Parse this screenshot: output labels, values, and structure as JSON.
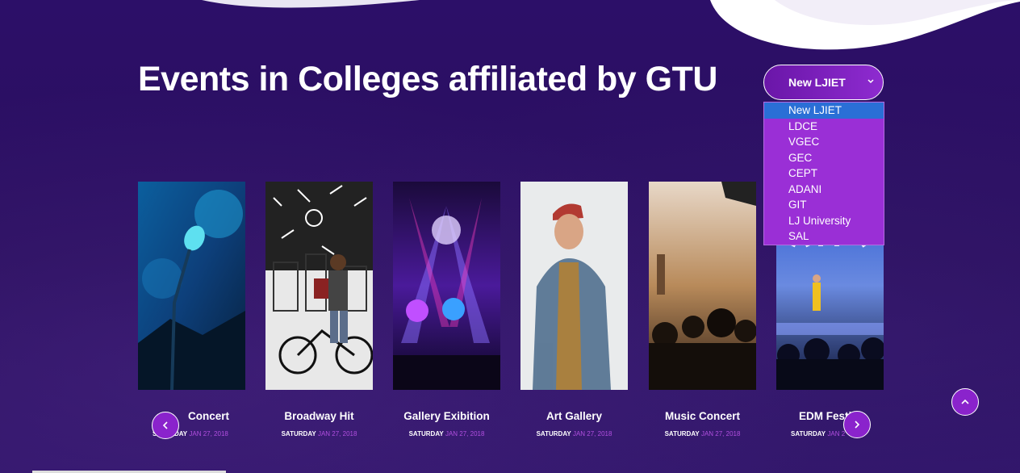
{
  "page": {
    "title": "Events in Colleges affiliated by GTU"
  },
  "college_select": {
    "selected": "New LJIET",
    "options": [
      "New LJIET",
      "LDCE",
      "VGEC",
      "GEC",
      "CEPT",
      "ADANI",
      "GIT",
      "LJ University",
      "SAL"
    ]
  },
  "events": [
    {
      "title": "Concert",
      "visible_title": "Concert",
      "day": "SATURDAY",
      "date": "JAN 27, 2018"
    },
    {
      "title": "Broadway Hit",
      "visible_title": "Broadway Hit",
      "day": "SATURDAY",
      "date": "JAN 27, 2018"
    },
    {
      "title": "Gallery Exibition",
      "visible_title": "Gallery Exibition",
      "day": "SATURDAY",
      "date": "JAN 27, 2018"
    },
    {
      "title": "Art Gallery",
      "visible_title": "Art Gallery",
      "day": "SATURDAY",
      "date": "JAN 27, 2018"
    },
    {
      "title": "Music Concert",
      "visible_title": "Music Concert",
      "day": "SATURDAY",
      "date": "JAN 27, 2018"
    },
    {
      "title": "EDM Festi",
      "visible_title": "EDM Festi",
      "day": "SATURDAY",
      "date": "JAN 2"
    }
  ],
  "colors": {
    "background": "#2a0f62",
    "accent": "#8a23cc",
    "date_accent": "#b24fe0",
    "dropdown_bg": "#9a2fd6",
    "dropdown_selected": "#2a6fd6"
  },
  "icons": {
    "select": "chevron-down-icon",
    "prev": "chevron-left-icon",
    "next": "chevron-right-icon",
    "scroll_top": "chevron-up-icon"
  }
}
